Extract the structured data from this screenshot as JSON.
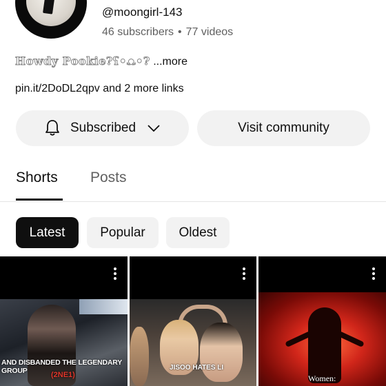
{
  "channel": {
    "handle": "@moongirl-143",
    "subscribers": "46 subscribers",
    "separator": "•",
    "videos": "77 videos",
    "description": "Howdy Pookie?ʕ•ᴥ•?",
    "description_more": " ...more",
    "links": "pin.it/2DoDL2qpv and 2 more links"
  },
  "actions": {
    "subscribe_label": "Subscribed",
    "community_label": "Visit community"
  },
  "tabs": [
    {
      "label": "Shorts",
      "active": true
    },
    {
      "label": "Posts",
      "active": false
    }
  ],
  "filters": [
    {
      "label": "Latest",
      "selected": true
    },
    {
      "label": "Popular",
      "selected": false
    },
    {
      "label": "Oldest",
      "selected": false
    }
  ],
  "shorts": [
    {
      "caption": "AND DISBANDED THE LEGENDARY GROUP",
      "caption2": "(2NE1)"
    },
    {
      "caption": "JISOO HATES LI"
    },
    {
      "caption": "Women:"
    }
  ],
  "colors": {
    "chip_selected_bg": "#0f0f0f",
    "chip_bg": "#f2f2f2",
    "button_bg": "#f2f2f2",
    "secondary_text": "#606060"
  },
  "icons": {
    "bell": "bell-icon",
    "chevron": "chevron-down-icon",
    "menu": "more-vert-icon"
  }
}
